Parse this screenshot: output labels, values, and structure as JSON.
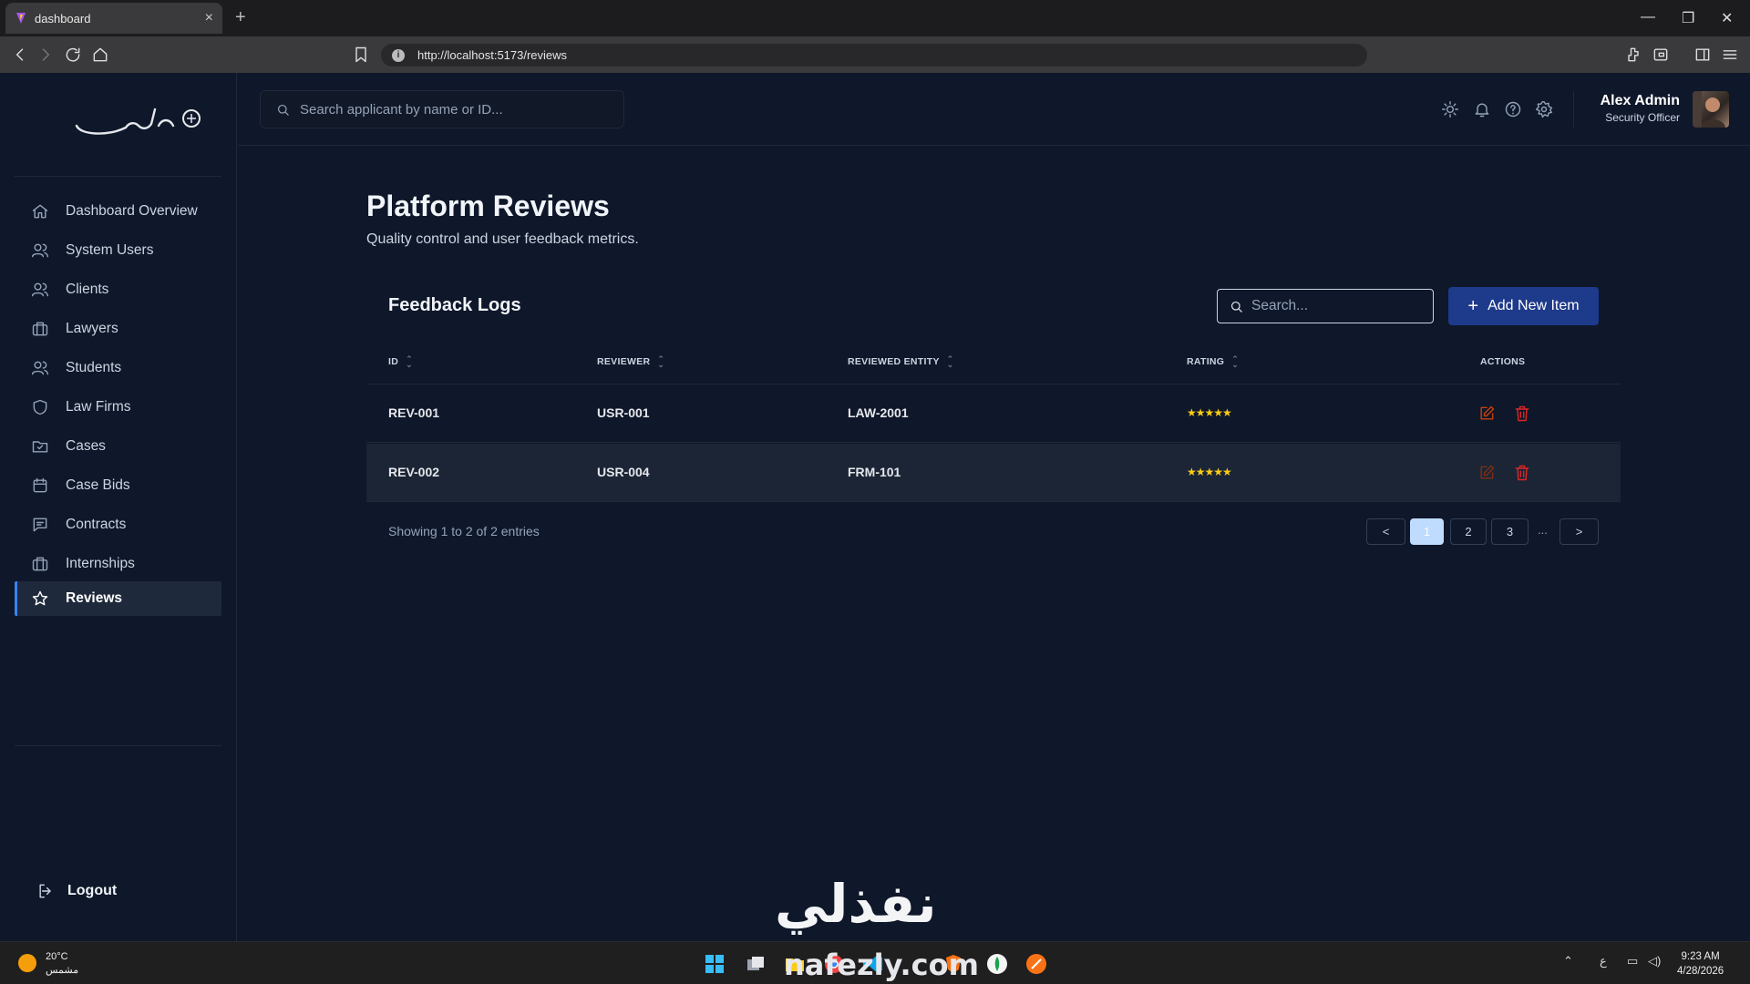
{
  "browser": {
    "tab_title": "dashboard",
    "tab_close": "×",
    "new_tab": "+",
    "url": "http://localhost:5173/reviews",
    "url_info": "i"
  },
  "sidebar": {
    "items": [
      {
        "label": "Dashboard Overview",
        "icon": "home-icon"
      },
      {
        "label": "System Users",
        "icon": "users-icon"
      },
      {
        "label": "Clients",
        "icon": "users-icon"
      },
      {
        "label": "Lawyers",
        "icon": "briefcase-icon"
      },
      {
        "label": "Students",
        "icon": "users-icon"
      },
      {
        "label": "Law Firms",
        "icon": "shield-icon"
      },
      {
        "label": "Cases",
        "icon": "folder-icon"
      },
      {
        "label": "Case Bids",
        "icon": "calendar-icon"
      },
      {
        "label": "Contracts",
        "icon": "message-icon"
      },
      {
        "label": "Internships",
        "icon": "briefcase-icon"
      },
      {
        "label": "Reviews",
        "icon": "star-icon",
        "active": true
      }
    ],
    "logout_label": "Logout"
  },
  "header": {
    "search_placeholder": "Search applicant by name or ID...",
    "user_name": "Alex Admin",
    "user_role": "Security Officer"
  },
  "main": {
    "title": "Platform Reviews",
    "subtitle": "Quality control and user feedback metrics.",
    "card_title": "Feedback Logs",
    "table_search_placeholder": "Search...",
    "add_button": "Add New Item",
    "add_button_icon": "+",
    "columns": [
      "ID",
      "REVIEWER",
      "REVIEWED ENTITY",
      "RATING",
      "ACTIONS"
    ],
    "rows": [
      {
        "id": "REV-001",
        "reviewer": "USR-001",
        "entity": "LAW-2001",
        "rating": "★★★★★",
        "rating_value": 5
      },
      {
        "id": "REV-002",
        "reviewer": "USR-004",
        "entity": "FRM-101",
        "rating": "★★★★★",
        "rating_value": 5
      }
    ],
    "entries_text": "Showing 1 to 2 of 2 entries",
    "pagination": {
      "prev": "<",
      "pages": [
        "1",
        "2",
        "3"
      ],
      "ellipsis": "...",
      "next": ">",
      "current": "1"
    }
  },
  "watermark": {
    "arabic": "نفذلي",
    "latin": "nafezly.com"
  },
  "taskbar": {
    "temperature": "20°C",
    "weather": "مشمس",
    "time": "9:23 AM",
    "date": "4/28/2026",
    "lang": "ع"
  },
  "colors": {
    "background": "#0f172a",
    "accent": "#1e3a8a",
    "active_indicator": "#3b82f6",
    "star": "#facc15",
    "delete": "#dc2626",
    "edit": "#c2410c"
  }
}
